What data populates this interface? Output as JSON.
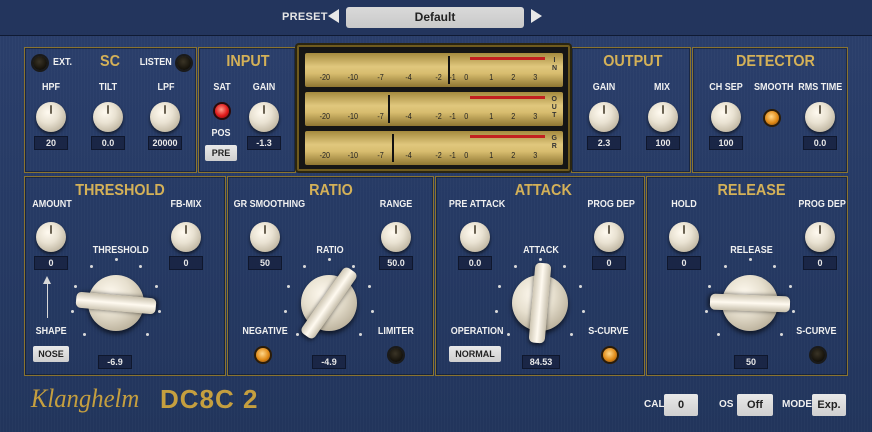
{
  "preset": {
    "label": "PRESET",
    "value": "Default"
  },
  "sc": {
    "title": "SC",
    "ext": "EXT.",
    "listen": "LISTEN",
    "hpf": "HPF",
    "tilt": "TILT",
    "lpf": "LPF",
    "hpf_val": "20",
    "tilt_val": "0.0",
    "lpf_val": "20000"
  },
  "input": {
    "title": "INPUT",
    "sat": "SAT",
    "gain": "GAIN",
    "pos": "POS",
    "pos_btn": "PRE",
    "gain_val": "-1.3"
  },
  "meter": {
    "ticks": [
      "-20",
      "-10",
      "-7",
      "-4",
      "-2",
      "-1",
      "0",
      "1",
      "2",
      "3"
    ],
    "rows": [
      {
        "side": "IN",
        "level": -1.5
      },
      {
        "side": "OUT",
        "level": -6.5
      },
      {
        "side": "GR",
        "level": -6.0
      }
    ]
  },
  "output": {
    "title": "OUTPUT",
    "gain": "GAIN",
    "mix": "MIX",
    "gain_val": "2.3",
    "mix_val": "100"
  },
  "detector": {
    "title": "DETECTOR",
    "ch_sep": "CH SEP",
    "smooth": "SMOOTH",
    "rms_time": "RMS TIME",
    "ch_sep_val": "100",
    "rms_time_val": "0.0"
  },
  "threshold": {
    "title": "THRESHOLD",
    "amount": "AMOUNT",
    "fb_mix": "FB-MIX",
    "threshold": "THRESHOLD",
    "shape": "SHAPE",
    "shape_btn": "NOSE",
    "amount_val": "0",
    "fb_mix_val": "0",
    "threshold_val": "-6.9"
  },
  "ratio": {
    "title": "RATIO",
    "gr_smoothing": "GR SMOOTHING",
    "range": "RANGE",
    "ratio": "RATIO",
    "negative": "NEGATIVE",
    "limiter": "LIMITER",
    "gr_smoothing_val": "50",
    "range_val": "50.0",
    "ratio_val": "-4.9"
  },
  "attack": {
    "title": "ATTACK",
    "pre_attack": "PRE ATTACK",
    "prog_dep": "PROG DEP",
    "attack": "ATTACK",
    "operation": "OPERATION",
    "operation_btn": "NORMAL",
    "s_curve": "S-CURVE",
    "pre_attack_val": "0.0",
    "prog_dep_val": "0",
    "attack_val": "84.53"
  },
  "release": {
    "title": "RELEASE",
    "hold": "HOLD",
    "prog_dep": "PROG DEP",
    "release": "RELEASE",
    "s_curve": "S-CURVE",
    "hold_val": "0",
    "prog_dep_val": "0",
    "release_val": "50"
  },
  "footer": {
    "brand": "Klanghelm",
    "product": "DC8C 2",
    "cal": "CAL",
    "cal_val": "0",
    "os": "OS",
    "os_val": "Off",
    "mode": "MODE",
    "mode_val": "Exp."
  },
  "colors": {
    "accent": "#d4b158",
    "panel": "#263a64",
    "amber_led": "#e08a17",
    "red_led": "#e01a1a"
  }
}
